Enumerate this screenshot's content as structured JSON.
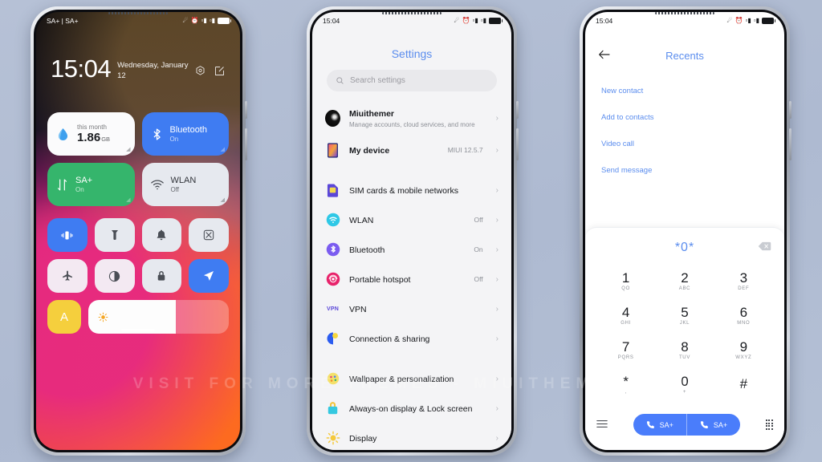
{
  "background_color": "#b2bed4",
  "watermark": "VISIT FOR MORE THEMES - MIUITHEMER.COM",
  "control_center": {
    "status_bar": {
      "carrier": "SA+ | SA+",
      "icons": [
        "bluetooth-icon",
        "alarm-icon",
        "sim1-signal-icon",
        "sim2-signal-icon",
        "battery-icon"
      ]
    },
    "time": "15:04",
    "date": "Wednesday, January 12",
    "action_icons": [
      "settings-gear-icon",
      "edit-icon"
    ],
    "tiles_large": [
      {
        "name": "data-usage",
        "pre": "this month",
        "value": "1.86",
        "unit": "GB",
        "icon": "data-drop-icon",
        "style": "light"
      },
      {
        "name": "bluetooth",
        "title": "Bluetooth",
        "sub": "On",
        "icon": "bluetooth-icon",
        "style": "blue"
      },
      {
        "name": "mobile-data",
        "title": "SA+",
        "sub": "On",
        "icon": "data-arrows-icon",
        "style": "green"
      },
      {
        "name": "wlan",
        "title": "WLAN",
        "sub": "Off",
        "icon": "wifi-icon",
        "style": "pale"
      }
    ],
    "tiles_small_row1": [
      {
        "name": "vibrate",
        "icon": "vibrate-icon",
        "active": true
      },
      {
        "name": "flashlight",
        "icon": "flashlight-icon",
        "active": false
      },
      {
        "name": "silent",
        "icon": "bell-icon",
        "active": false
      },
      {
        "name": "screenshot",
        "icon": "screenshot-icon",
        "active": false
      }
    ],
    "tiles_small_row2": [
      {
        "name": "airplane-mode",
        "icon": "airplane-icon",
        "active": false
      },
      {
        "name": "dark-mode",
        "icon": "contrast-icon",
        "active": false
      },
      {
        "name": "screen-lock",
        "icon": "lock-icon",
        "active": false
      },
      {
        "name": "location",
        "icon": "location-arrow-icon",
        "active": true
      }
    ],
    "brightness": {
      "auto_label": "A",
      "icon": "sun-icon",
      "level_percent": 62
    }
  },
  "settings": {
    "status_bar": {
      "time": "15:04"
    },
    "title": "Settings",
    "search": {
      "placeholder": "Search settings",
      "icon": "search-icon"
    },
    "groups": [
      {
        "rows": [
          {
            "name": "account",
            "label": "Miuithemer",
            "sub": "Manage accounts, cloud services, and more",
            "value": "",
            "icon": "avatar-icon"
          },
          {
            "name": "my-device",
            "label": "My device",
            "sub": "",
            "value": "MIUI 12.5.7",
            "icon": "device-icon"
          }
        ]
      },
      {
        "rows": [
          {
            "name": "sim-cards",
            "label": "SIM cards & mobile networks",
            "sub": "",
            "value": "",
            "icon": "sim-card-icon"
          },
          {
            "name": "wlan",
            "label": "WLAN",
            "sub": "",
            "value": "Off",
            "icon": "wifi-icon"
          },
          {
            "name": "bluetooth",
            "label": "Bluetooth",
            "sub": "",
            "value": "On",
            "icon": "bluetooth-icon"
          },
          {
            "name": "portable-hotspot",
            "label": "Portable hotspot",
            "sub": "",
            "value": "Off",
            "icon": "hotspot-icon"
          },
          {
            "name": "vpn",
            "label": "VPN",
            "sub": "",
            "value": "",
            "icon": "vpn-icon"
          },
          {
            "name": "connection-sharing",
            "label": "Connection & sharing",
            "sub": "",
            "value": "",
            "icon": "connection-icon"
          }
        ]
      },
      {
        "rows": [
          {
            "name": "wallpaper",
            "label": "Wallpaper & personalization",
            "sub": "",
            "value": "",
            "icon": "palette-icon"
          },
          {
            "name": "always-on-display",
            "label": "Always-on display & Lock screen",
            "sub": "",
            "value": "",
            "icon": "lock-icon"
          },
          {
            "name": "display",
            "label": "Display",
            "sub": "",
            "value": "",
            "icon": "brightness-icon"
          }
        ]
      }
    ]
  },
  "dialer": {
    "status_bar": {
      "time": "15:04"
    },
    "back_icon": "back-arrow-icon",
    "title": "Recents",
    "actions": [
      {
        "name": "new-contact",
        "label": "New contact"
      },
      {
        "name": "add-to-contacts",
        "label": "Add to contacts"
      },
      {
        "name": "video-call",
        "label": "Video call"
      },
      {
        "name": "send-message",
        "label": "Send message"
      }
    ],
    "number": "*0*",
    "backspace_icon": "backspace-icon",
    "keys": [
      {
        "digit": "1",
        "letters": "QO"
      },
      {
        "digit": "2",
        "letters": "ABC"
      },
      {
        "digit": "3",
        "letters": "DEF"
      },
      {
        "digit": "4",
        "letters": "GHI"
      },
      {
        "digit": "5",
        "letters": "JKL"
      },
      {
        "digit": "6",
        "letters": "MNO"
      },
      {
        "digit": "7",
        "letters": "PQRS"
      },
      {
        "digit": "8",
        "letters": "TUV"
      },
      {
        "digit": "9",
        "letters": "WXYZ"
      },
      {
        "digit": "*",
        "letters": ","
      },
      {
        "digit": "0",
        "letters": "+"
      },
      {
        "digit": "#",
        "letters": ""
      }
    ],
    "bottom": {
      "menu_icon": "menu-icon",
      "call_buttons": [
        {
          "name": "call-sim1",
          "label": "SA+",
          "icon": "phone-icon"
        },
        {
          "name": "call-sim2",
          "label": "SA+",
          "icon": "phone-icon"
        }
      ],
      "keypad_icon": "keypad-icon"
    },
    "accent_color": "#4a7dfb",
    "link_color": "#5b8dee"
  }
}
